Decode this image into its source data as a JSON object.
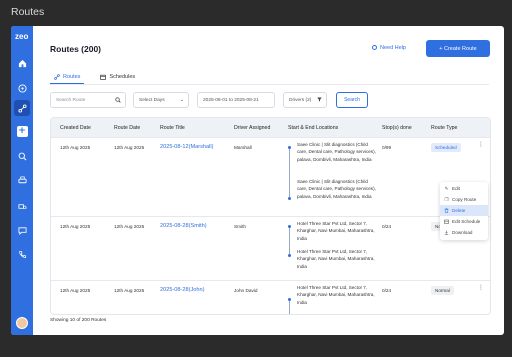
{
  "window": {
    "title": "Routes"
  },
  "sidebar": {
    "logo": "zeo",
    "icons": [
      "home-icon",
      "compass-icon",
      "route-icon",
      "plus-icon",
      "search-icon",
      "printer-icon",
      "truck-icon",
      "chat-icon",
      "phone-icon",
      "avatar"
    ]
  },
  "header": {
    "title": "Routes (200)",
    "need_help": "Need Help",
    "create_button": "+ Create Route"
  },
  "tabs": [
    {
      "label": "Routes",
      "active": true
    },
    {
      "label": "Schedules",
      "active": false
    }
  ],
  "filters": {
    "search_placeholder": "Search Route",
    "days": "Select Days",
    "date_range": "2025-08-01 to  2025-08-21",
    "drivers": "Drivers (2)",
    "search_button": "Search"
  },
  "table": {
    "headers": [
      "Created Date",
      "Route Date",
      "Route Title",
      "Driver Assigned",
      "Start & End Locations",
      "Stop(s) done",
      "Route Type"
    ],
    "rows": [
      {
        "created": "12th Aug 2025",
        "route_date": "12th Aug 2025",
        "title": "2025-08-12(Marshall)",
        "driver": "Marshall",
        "start": "Saee Clinic | Slit diagnostics (Child care, Dental care, Pathology services), palava, Dombivli, Maharashtra, India",
        "end": "Saee Clinic | Slit diagnostics (Child care, Dental care, Pathology services), palava, Dombivli, Maharashtra, India",
        "stops": "0/99",
        "type": "Scheduled"
      },
      {
        "created": "12th Aug 2025",
        "route_date": "12th Aug 2025",
        "title": "2025-08-28(Smith)",
        "driver": "Smith",
        "start": "Hotel Three Star Pvt Ltd, Sector 7, Kharghar, Navi Mumbai, Maharashtra, India",
        "end": "Hotel Three Star Pvt Ltd, Sector 7, Kharghar, Navi Mumbai, Maharashtra, India",
        "stops": "0/24",
        "type": "Normal"
      },
      {
        "created": "12th Aug 2025",
        "route_date": "12th Aug 2025",
        "title": "2025-08-28(John)",
        "driver": "John David",
        "start": "Hotel Three Star Pvt Ltd, Sector 7, Kharghar, Navi Mumbai, Maharashtra, India",
        "end": "",
        "stops": "0/24",
        "type": "Normal"
      }
    ]
  },
  "context_menu": {
    "items": [
      {
        "label": "Edit",
        "icon": "pencil-icon"
      },
      {
        "label": "Copy Route",
        "icon": "copy-icon"
      },
      {
        "label": "Delete",
        "icon": "trash-icon",
        "highlighted": true
      },
      {
        "label": "Edit Schedule",
        "icon": "calendar-edit-icon"
      },
      {
        "label": "Download",
        "icon": "download-icon"
      }
    ]
  },
  "footer": {
    "text": "Showing 10 of 200 Routes"
  },
  "colors": {
    "primary": "#2f6fdf",
    "sidebar": "#2f6fdf",
    "badge_scheduled_bg": "#e2ebfb"
  }
}
